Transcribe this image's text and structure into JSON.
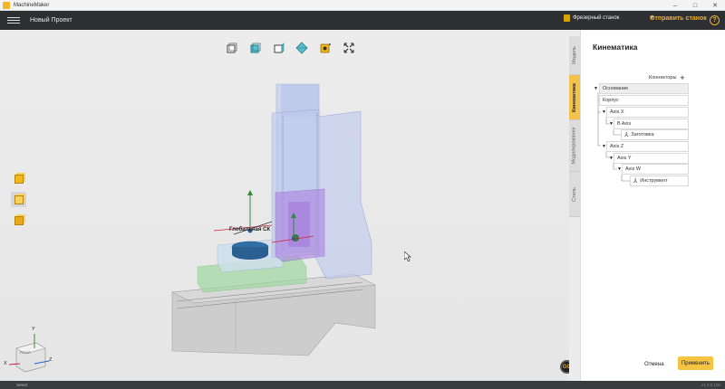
{
  "window": {
    "app_name": "MachineMaker",
    "minimize": "–",
    "maximize": "□",
    "close": "✕"
  },
  "header": {
    "project_name": "Новый Проект",
    "machine_type": "Фрезерный станок",
    "send_label": "Отправить станок",
    "help_label": "?"
  },
  "viewport": {
    "scene_label": "Глобальная СК",
    "view_toolbar": [
      "view-front-icon",
      "view-iso-icon",
      "view-side-icon",
      "view-top-icon",
      "render-mode-icon",
      "fit-view-icon"
    ],
    "left_tools": [
      "solid-cube-icon",
      "wireframe-cube-icon",
      "shaded-cube-icon"
    ],
    "axes": {
      "y": "Y",
      "x": "X",
      "z": "Z"
    },
    "gizmo_label": "GG",
    "cube_label": "FRONT"
  },
  "tabs": [
    "Модель",
    "Кинематика",
    "Моделирование",
    "Стиль"
  ],
  "active_tab": "Кинематика",
  "panel": {
    "title": "Кинематика",
    "connectors_label": "Коннекторы",
    "connectors_add": "+",
    "tree": [
      {
        "label": "Основание",
        "type": "root"
      },
      {
        "label": "Корпус",
        "type": "node"
      },
      {
        "label": "Axis X",
        "type": "axis"
      },
      {
        "label": "B Axis",
        "type": "axis"
      },
      {
        "label": "Заготовка",
        "type": "joint"
      },
      {
        "label": "Axis Z",
        "type": "axis"
      },
      {
        "label": "Axis Y",
        "type": "axis"
      },
      {
        "label": "Axis W",
        "type": "axis"
      },
      {
        "label": "Инструмент",
        "type": "joint"
      }
    ],
    "cancel_label": "Отмена",
    "apply_label": "Применить"
  },
  "status": {
    "text": "Select",
    "version": "v1.0.0.100"
  },
  "colors": {
    "accent": "#f5c542",
    "header_bg": "#2d2f33",
    "active_tab": "#f4c24a"
  }
}
